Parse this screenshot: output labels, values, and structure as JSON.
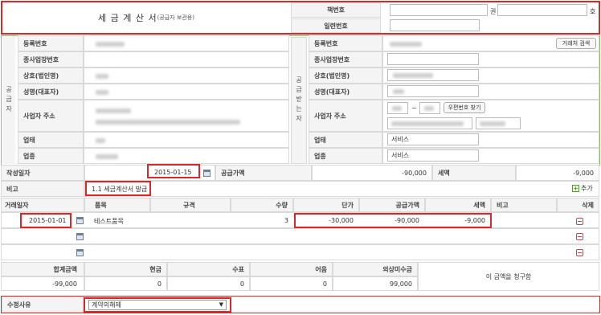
{
  "header": {
    "title": "세 금 계 산 서",
    "subtitle": "(공급자 보관용)",
    "book_no_label": "책번호",
    "vol_label": "권",
    "ho_label": "호",
    "serial_label": "일련번호"
  },
  "supplier": {
    "side_label": "공급자",
    "reg_no_label": "등록번호",
    "sub_biz_label": "종사업장번호",
    "company_label": "상호(법인명)",
    "name_label": "성명(대표자)",
    "address_label": "사업자 주소",
    "biz_type_label": "업태",
    "biz_item_label": "업종"
  },
  "receiver": {
    "side_label": "공급받는자",
    "reg_no_label": "등록번호",
    "search_button": "거래처 검색",
    "sub_biz_label": "종사업장번호",
    "company_label": "상호(법인명)",
    "name_label": "성명(대표자)",
    "address_label": "사업자 주소",
    "zip_sep": "~",
    "zip_button": "우편번호 찾기",
    "biz_type_label": "업태",
    "biz_type_value": "서비스",
    "biz_item_label": "업종",
    "biz_item_value": "서비스"
  },
  "summary": {
    "date_label": "작성일자",
    "date_value": "2015-01-15",
    "supply_label": "공급가액",
    "supply_value": "-90,000",
    "tax_label": "세액",
    "tax_value": "-9,000",
    "note_label": "비고",
    "note_value": "1.1 세금계산서 발급",
    "add_label": "추가"
  },
  "items": {
    "headers": [
      "거래일자",
      "품목",
      "규격",
      "수량",
      "단가",
      "공급가액",
      "세액",
      "비고",
      "삭제"
    ],
    "rows": [
      {
        "date": "2015-01-01",
        "item": "테스트품목",
        "spec": "",
        "qty": "3",
        "price": "-30,000",
        "supply": "-90,000",
        "tax": "-9,000",
        "note": ""
      }
    ]
  },
  "totals": {
    "headers": [
      "합계금액",
      "현금",
      "수표",
      "어음",
      "외상미수금"
    ],
    "values": [
      "-99,000",
      "0",
      "0",
      "0",
      "99,000"
    ],
    "claim_text": "이 금액을 청구함"
  },
  "reason": {
    "label": "수정사유",
    "selected": "계약의해제"
  },
  "colors": {
    "highlight": "#d42a2a",
    "label_bg": "#f4f4f4",
    "border": "#d9d9d9"
  }
}
